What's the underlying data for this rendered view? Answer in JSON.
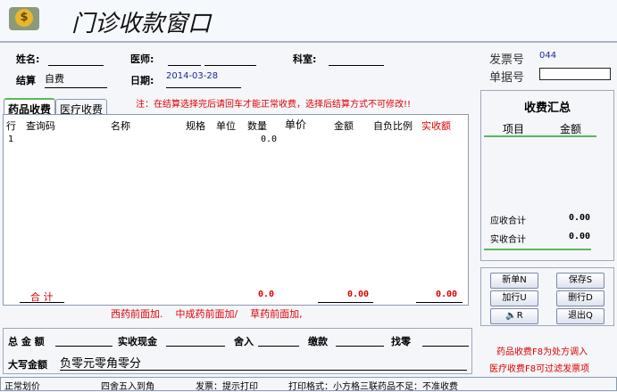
{
  "title": "门诊收款窗口",
  "form": {
    "name_label": "姓名:",
    "doctor_label": "医师:",
    "dept_label": "科室:",
    "settle_label": "结算",
    "settle_value": "自费",
    "date_label": "日期:",
    "date_value": "2014-03-28",
    "invoice_label": "发票号",
    "invoice_value": "044",
    "receipt_label": "单据号"
  },
  "notice": "注：在结算选择完后请回车才能正常收费，选择后结算方式不可修改!!",
  "tabs": [
    {
      "label": "药品收费"
    },
    {
      "label": "医疗收费"
    }
  ],
  "table": {
    "headers": [
      "行",
      "查询码",
      "名称",
      "规格",
      "单位",
      "数量",
      "单价",
      "金额",
      "自负比例",
      "实收额"
    ],
    "rows": [
      {
        "row": "1",
        "qty": "0.0"
      }
    ],
    "total_label": "合 计",
    "total_qty": "0.0",
    "total_amount": "0.00",
    "total_received": "0.00"
  },
  "hint": "西药前面加.    中成药前面加/    草药前面加,",
  "summary": {
    "title": "收费汇总",
    "col_item": "项目",
    "col_amount": "金额",
    "receivable_label": "应收合计",
    "receivable_value": "0.00",
    "received_label": "实收合计",
    "received_value": "0.00"
  },
  "buttons": {
    "new": "新单N",
    "save": "保存S",
    "add_row": "加行U",
    "del_row": "删行D",
    "sound": "R",
    "exit": "退出Q"
  },
  "tips": [
    "药品收费F8为处方调入",
    "医疗收费F8可过滤发票项"
  ],
  "bottom": {
    "total_label": "总 金 额",
    "cash_label": "实收现金",
    "round_label": "舍入",
    "pay_label": "缴款",
    "change_label": "找零",
    "upper_label": "大写金额",
    "upper_value": "负零元零角零分"
  },
  "status": [
    "正常划价",
    "四舍五入到角",
    "发票：提示打印",
    "打印格式：小方格三联药品不足：不准收费"
  ]
}
